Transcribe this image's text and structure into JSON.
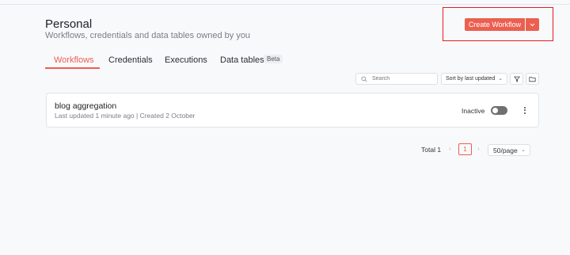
{
  "header": {
    "title": "Personal",
    "subtitle": "Workflows, credentials and data tables owned by you",
    "create_button": "Create Workflow"
  },
  "tabs": [
    {
      "label": "Workflows",
      "active": true
    },
    {
      "label": "Credentials",
      "active": false
    },
    {
      "label": "Executions",
      "active": false
    },
    {
      "label": "Data tables",
      "active": false,
      "badge": "Beta"
    }
  ],
  "toolbar": {
    "search_placeholder": "Search",
    "sort_label": "Sort by last updated"
  },
  "workflows": [
    {
      "name": "blog aggregation",
      "meta": "Last updated 1 minute ago | Created 2 October",
      "status": "Inactive",
      "active": false
    }
  ],
  "pagination": {
    "total": "Total 1",
    "current_page": "1",
    "page_size": "50/page"
  },
  "colors": {
    "accent": "#ec5f4f",
    "highlight_box": "#e11d26"
  }
}
